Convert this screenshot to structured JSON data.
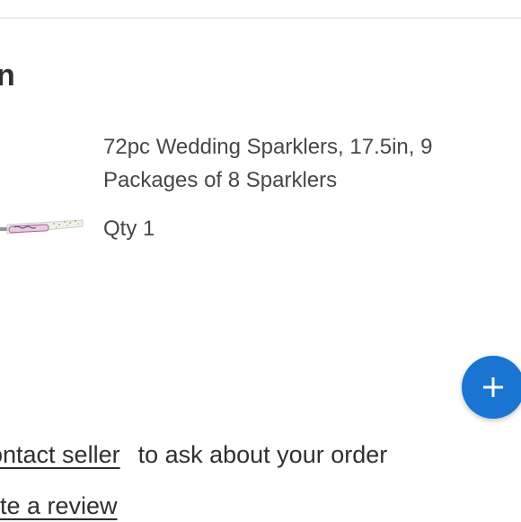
{
  "section": {
    "title": "n"
  },
  "product": {
    "thumbnail": "sparkler-package-image",
    "name": "72pc Wedding Sparklers, 17.5in, 9 Packages of 8 Sparklers",
    "qty": "Qty 1"
  },
  "fab": {
    "icon": "plus-icon",
    "color": "#1a75d2"
  },
  "actions": {
    "contact_seller_label": "ontact seller",
    "contact_seller_suffix": "to ask about your order",
    "write_review_label": "rite a review"
  }
}
